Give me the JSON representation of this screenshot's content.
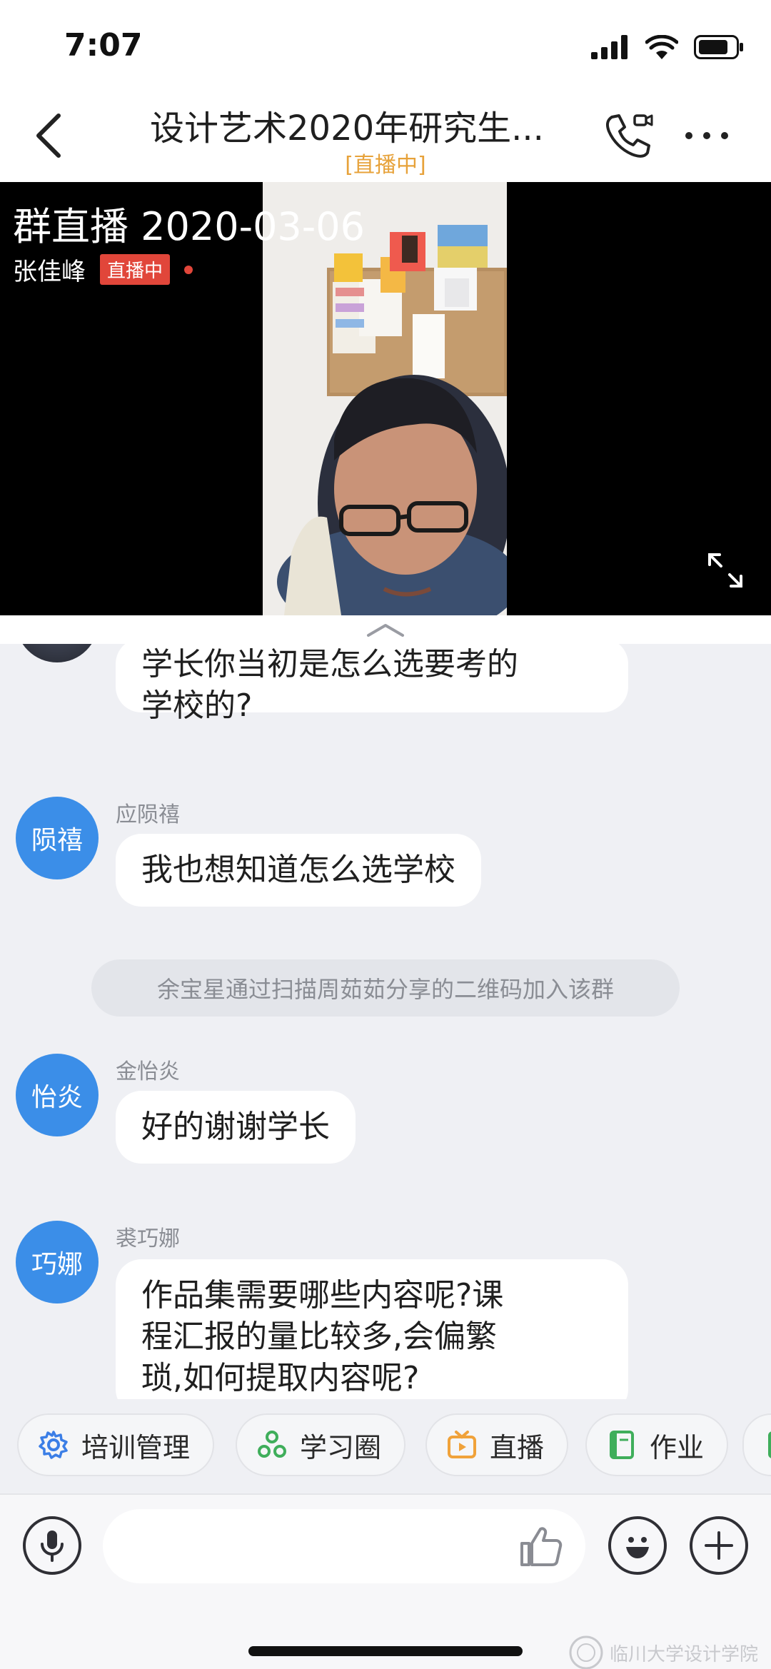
{
  "status_bar": {
    "time": "7:07"
  },
  "nav": {
    "title": "设计艺术2020年研究生...",
    "subtitle": "[直播中]"
  },
  "live": {
    "title": "群直播 2020-03-06",
    "host_name": "张佳峰",
    "badge": "直播中"
  },
  "chat": {
    "messages": [
      {
        "sender": "",
        "avatar_text": "",
        "text": "学长你当初是怎么选要考的\n学校的?"
      },
      {
        "sender": "应陨禧",
        "avatar_text": "陨禧",
        "text": "我也想知道怎么选学校"
      },
      {
        "notice": "余宝星通过扫描周茹茹分享的二维码加入该群"
      },
      {
        "sender": "金怡炎",
        "avatar_text": "怡炎",
        "text": "好的谢谢学长"
      },
      {
        "sender": "裘巧娜",
        "avatar_text": "巧娜",
        "text": "作品集需要哪些内容呢?课\n程汇报的量比较多,会偏繁\n琐,如何提取内容呢?"
      }
    ]
  },
  "shortcuts": [
    {
      "label": "培训管理",
      "icon": "gear-icon",
      "color": "#3b7ee6"
    },
    {
      "label": "学习圈",
      "icon": "circles-icon",
      "color": "#3fae5b"
    },
    {
      "label": "直播",
      "icon": "tv-icon",
      "color": "#f0a23a"
    },
    {
      "label": "作业",
      "icon": "book-icon",
      "color": "#3fae5b"
    }
  ],
  "input": {
    "placeholder": ""
  },
  "watermark": "临川大学设计学院"
}
